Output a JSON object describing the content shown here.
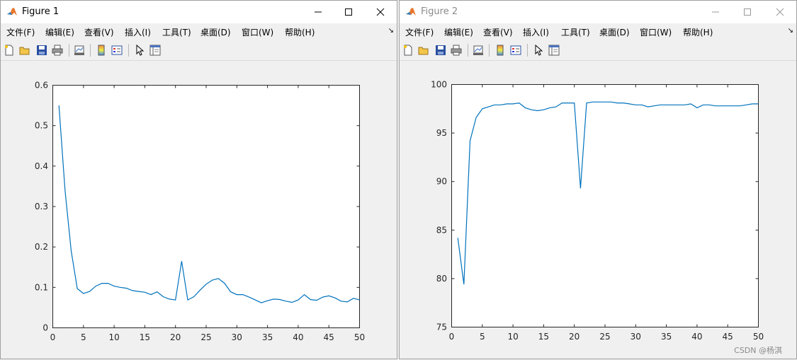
{
  "windows": [
    {
      "title": "Figure 1",
      "active": true,
      "menu": [
        "文件(F)",
        "编辑(E)",
        "查看(V)",
        "插入(I)",
        "工具(T)",
        "桌面(D)",
        "窗口(W)",
        "帮助(H)"
      ]
    },
    {
      "title": "Figure 2",
      "active": false,
      "menu": [
        "文件(F)",
        "编辑(E)",
        "查看(V)",
        "插入(I)",
        "工具(T)",
        "桌面(D)",
        "窗口(W)",
        "帮助(H)"
      ]
    }
  ],
  "toolbar_icons": [
    "new-file-icon",
    "open-folder-icon",
    "save-icon",
    "print-icon",
    "link-plot-icon",
    "colorbar-icon",
    "legend-icon",
    "pointer-icon",
    "property-inspector-icon"
  ],
  "colors": {
    "line": "#0072bd",
    "window_bg": "#f0f0f0",
    "axes_bg": "#ffffff"
  },
  "chart_data": [
    {
      "type": "line",
      "title": "",
      "xlabel": "",
      "ylabel": "",
      "xlim": [
        0,
        50
      ],
      "ylim": [
        0,
        0.6
      ],
      "xticks": [
        0,
        5,
        10,
        15,
        20,
        25,
        30,
        35,
        40,
        45,
        50
      ],
      "yticks": [
        0,
        0.1,
        0.2,
        0.3,
        0.4,
        0.5,
        0.6
      ],
      "x": [
        1,
        2,
        3,
        4,
        5,
        6,
        7,
        8,
        9,
        10,
        11,
        12,
        13,
        14,
        15,
        16,
        17,
        18,
        19,
        20,
        21,
        22,
        23,
        24,
        25,
        26,
        27,
        28,
        29,
        30,
        31,
        32,
        33,
        34,
        35,
        36,
        37,
        38,
        39,
        40,
        41,
        42,
        43,
        44,
        45,
        46,
        47,
        48,
        49,
        50
      ],
      "values": [
        0.55,
        0.34,
        0.19,
        0.097,
        0.085,
        0.09,
        0.103,
        0.11,
        0.11,
        0.103,
        0.1,
        0.098,
        0.092,
        0.09,
        0.088,
        0.082,
        0.089,
        0.077,
        0.071,
        0.069,
        0.165,
        0.069,
        0.077,
        0.093,
        0.108,
        0.118,
        0.122,
        0.11,
        0.089,
        0.082,
        0.082,
        0.076,
        0.069,
        0.062,
        0.067,
        0.071,
        0.07,
        0.066,
        0.063,
        0.069,
        0.082,
        0.07,
        0.068,
        0.076,
        0.079,
        0.074,
        0.066,
        0.064,
        0.073,
        0.069
      ],
      "grid": false
    },
    {
      "type": "line",
      "title": "",
      "xlabel": "",
      "ylabel": "",
      "xlim": [
        0,
        50
      ],
      "ylim": [
        75,
        100
      ],
      "xticks": [
        0,
        5,
        10,
        15,
        20,
        25,
        30,
        35,
        40,
        45,
        50
      ],
      "yticks": [
        75,
        80,
        85,
        90,
        95,
        100
      ],
      "x": [
        1,
        2,
        3,
        4,
        5,
        6,
        7,
        8,
        9,
        10,
        11,
        12,
        13,
        14,
        15,
        16,
        17,
        18,
        19,
        20,
        21,
        22,
        23,
        24,
        25,
        26,
        27,
        28,
        29,
        30,
        31,
        32,
        33,
        34,
        35,
        36,
        37,
        38,
        39,
        40,
        41,
        42,
        43,
        44,
        45,
        46,
        47,
        48,
        49,
        50
      ],
      "values": [
        84.2,
        79.4,
        94.2,
        96.6,
        97.5,
        97.7,
        97.9,
        97.9,
        98.0,
        98.0,
        98.1,
        97.6,
        97.4,
        97.3,
        97.4,
        97.6,
        97.7,
        98.1,
        98.1,
        98.1,
        89.3,
        98.1,
        98.2,
        98.2,
        98.2,
        98.2,
        98.1,
        98.1,
        98.0,
        97.9,
        97.9,
        97.7,
        97.8,
        97.9,
        97.9,
        97.9,
        97.9,
        97.9,
        98.0,
        97.6,
        97.9,
        97.9,
        97.8,
        97.8,
        97.8,
        97.8,
        97.8,
        97.9,
        98.0,
        98.0
      ],
      "grid": false
    }
  ],
  "watermark": "CSDN @杨淇"
}
